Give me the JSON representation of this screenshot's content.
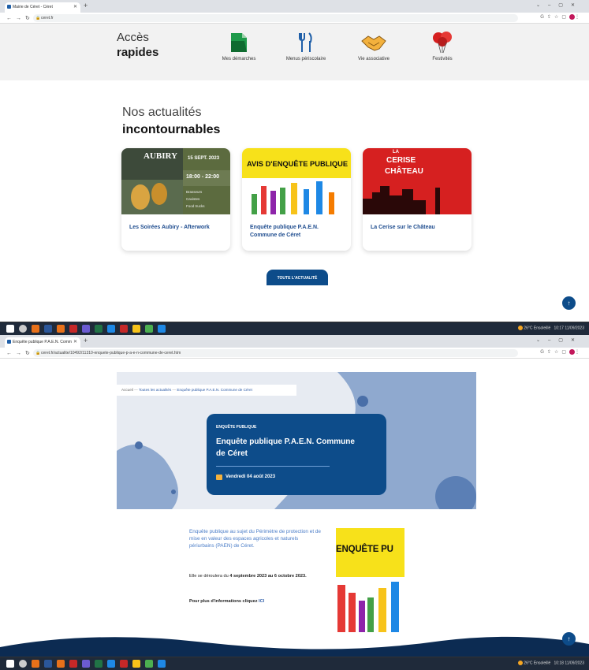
{
  "shot1": {
    "browser": {
      "tab_title": "Mairie de Céret - Céret",
      "url": "ceret.fr"
    },
    "quick_access": {
      "title_line1": "Accès",
      "title_line2": "rapides",
      "items": [
        {
          "label": "Mes démarches",
          "icon": "folder-icon"
        },
        {
          "label": "Menus périscolaire",
          "icon": "cutlery-icon"
        },
        {
          "label": "Vie associative",
          "icon": "handshake-icon"
        },
        {
          "label": "Festivités",
          "icon": "balloons-icon"
        }
      ]
    },
    "news": {
      "title_line1": "Nos actualités",
      "title_line2": "incontournables",
      "cards": [
        {
          "title": "Les Soirées Aubiry - Afterwork",
          "image": {
            "brand": "AUBIRY",
            "date": "15 SEPT. 2023",
            "time": "18:00 - 22:00",
            "lines": [
              "Brasseurs",
              "Cavistes",
              "Food trucks"
            ]
          }
        },
        {
          "title": "Enquête publique P.A.E.N. Commune de Céret",
          "image": {
            "banner": "AVIS D'ENQUÊTE PUBLIQUE"
          }
        },
        {
          "title": "La Cerise sur le Château",
          "image": {
            "line1": "LA",
            "line2": "CERISE",
            "line3": "CHÂTEAU"
          }
        }
      ],
      "all_button": "TOUTE L'ACTUALITÉ"
    },
    "taskbar": {
      "weather": "26°C Ensoleillé",
      "time": "10:17",
      "date": "11/09/2023"
    }
  },
  "shot2": {
    "browser": {
      "tab_title": "Enquête publique P.A.E.N. Comm",
      "url": "ceret.fr/actualite/10492/11310-enquete-publique-p-a-e-n-commune-de-ceret.htm"
    },
    "breadcrumb": [
      "Accueil",
      "Toutes les actualités",
      "Enquête publique P.A.E.N. Commune de Céret"
    ],
    "article": {
      "kind": "ENQUÊTE PUBLIQUE",
      "title": "Enquête publique P.A.E.N. Commune de Céret",
      "date": "Vendredi 04 août 2023",
      "intro": "Enquête publique au sujet du Périmètre de protection et de mise en valeur des espaces agricoles et naturels périurbains (PAEN) de Céret.",
      "dates_prefix": "Elle se déroulera du ",
      "dates_bold": "4 septembre 2023 au 6 octobre 2023.",
      "more_text": "Pour plus d'informations cliquez ",
      "more_link": "ICI",
      "poster_text": "ENQUÊTE PU"
    },
    "taskbar": {
      "weather": "26°C Ensoleillé",
      "time": "10:18",
      "date": "11/09/2023"
    }
  },
  "colors": {
    "primary": "#0d4c8a",
    "link": "#2e5da8",
    "yellow": "#f7e11a",
    "red": "#d62020"
  }
}
